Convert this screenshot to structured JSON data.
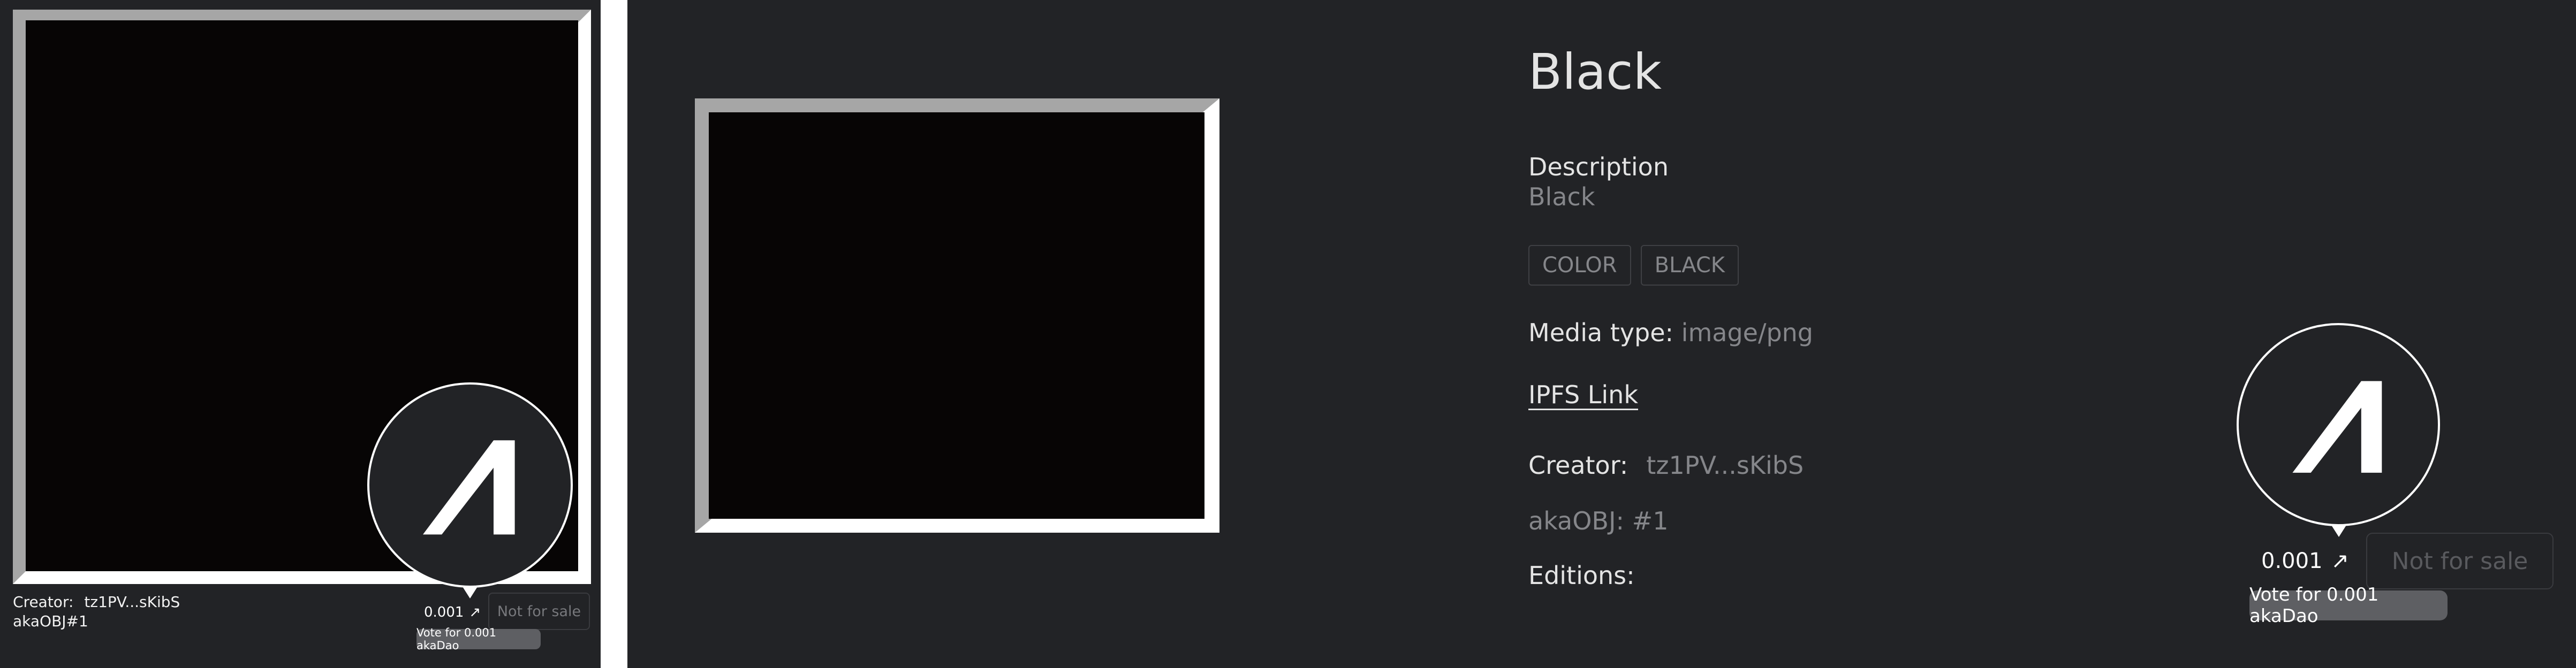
{
  "card": {
    "creator_label": "Creator:",
    "creator_address": "tz1PV...sKibS",
    "object_id": "akaOBJ#1",
    "price": "0.001",
    "price_icon": "arrow-up-right-icon",
    "sale_status": "Not for sale",
    "vote_tooltip": "Vote for 0.001 akaDao",
    "badge_icon": "akaswap-logo-icon"
  },
  "detail": {
    "title": "Black",
    "description_label": "Description",
    "description_value": "Black",
    "tags": [
      "COLOR",
      "BLACK"
    ],
    "media_label": "Media type:",
    "media_value": "image/png",
    "ipfs_link": "IPFS Link",
    "creator_label": "Creator:",
    "creator_address": "tz1PV...sKibS",
    "object_id": "akaOBJ: #1",
    "editions_label": "Editions:",
    "price": "0.001",
    "price_icon": "arrow-up-right-icon",
    "sale_status": "Not for sale",
    "vote_tooltip": "Vote for 0.001 akaDao",
    "badge_icon": "akaswap-logo-icon"
  },
  "colors": {
    "background": "#222326",
    "artwork": "#070505",
    "frame": "#ffffff",
    "bevel": "#a6a6a6",
    "tooltip": "#5e5f63"
  }
}
